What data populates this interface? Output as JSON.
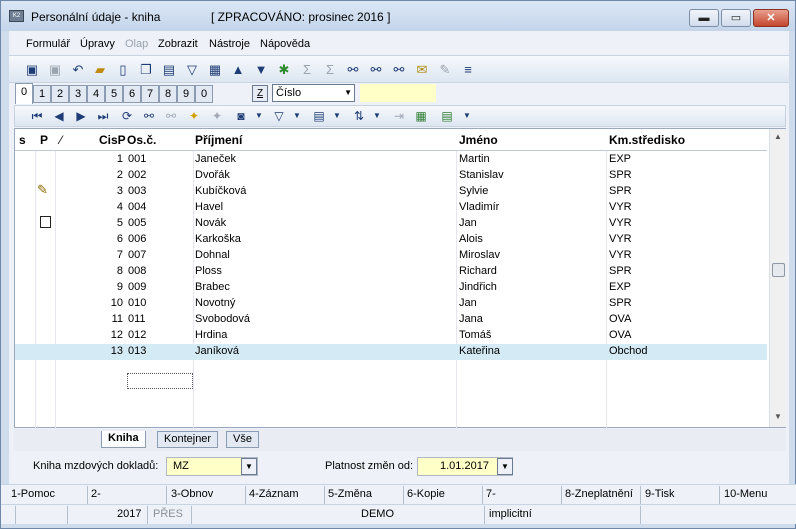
{
  "window": {
    "title": "Personální údaje - kniha",
    "status": "[ ZPRACOVÁNO: prosinec 2016 ]",
    "min_glyph": "▬",
    "max_glyph": "▭",
    "close_glyph": "✕"
  },
  "menu": [
    "Formulář",
    "Úpravy",
    "Olap",
    "Zobrazit",
    "Nástroje",
    "Nápověda"
  ],
  "menu_disabled": [
    "Olap"
  ],
  "toolbar_icons": [
    "save-icon",
    "save-as-icon",
    "undo-icon",
    "open-folder-icon",
    "new-document-icon",
    "copy-icon",
    "book-icon",
    "filter-icon",
    "filter-document-icon",
    "arrow-up-icon",
    "arrow-down-icon",
    "refresh-icon",
    "sum-icon",
    "sum-alt-icon",
    "binoculars-icon",
    "binoculars-next-icon",
    "binoculars-list-icon",
    "mail-icon",
    "edit-icon",
    "list-icon"
  ],
  "number_tabs": [
    "0",
    "1",
    "2",
    "3",
    "4",
    "5",
    "6",
    "7",
    "8",
    "9",
    "0"
  ],
  "sort": {
    "z_label": "Z",
    "selected": "Číslo"
  },
  "nav_toolbar_icons": [
    "first-icon",
    "prev-icon",
    "next-icon",
    "last-icon",
    "refresh-icon",
    "binoculars-icon",
    "binoculars-disabled-icon",
    "star-add-icon",
    "star-remove-icon",
    "camera-icon",
    "filter-icon",
    "columns-icon",
    "sort-icon",
    "indent-icon",
    "excel-icon",
    "notes-icon"
  ],
  "table": {
    "headers": {
      "s": "s",
      "p": "P",
      "mark": "⁄",
      "cisp": "CisP",
      "osc": "Os.č.",
      "prijmeni": "Příjmení",
      "jmeno": "Jméno",
      "stredisko": "Km.středisko"
    },
    "rows": [
      {
        "cisp": "1",
        "osc": "001",
        "prijmeni": "Janeček",
        "jmeno": "Martin",
        "stredisko": "EXP"
      },
      {
        "cisp": "2",
        "osc": "002",
        "prijmeni": "Dvořák",
        "jmeno": "Stanislav",
        "stredisko": "SPR"
      },
      {
        "cisp": "3",
        "osc": "003",
        "prijmeni": "Kubíčková",
        "jmeno": "Sylvie",
        "stredisko": "SPR"
      },
      {
        "cisp": "4",
        "osc": "004",
        "prijmeni": "Havel",
        "jmeno": "Vladimír",
        "stredisko": "VYR"
      },
      {
        "cisp": "5",
        "osc": "005",
        "prijmeni": "Novák",
        "jmeno": "Jan",
        "stredisko": "VYR"
      },
      {
        "cisp": "6",
        "osc": "006",
        "prijmeni": "Karkoška",
        "jmeno": "Alois",
        "stredisko": "VYR"
      },
      {
        "cisp": "7",
        "osc": "007",
        "prijmeni": "Dohnal",
        "jmeno": "Miroslav",
        "stredisko": "VYR"
      },
      {
        "cisp": "8",
        "osc": "008",
        "prijmeni": "Ploss",
        "jmeno": "Richard",
        "stredisko": "SPR"
      },
      {
        "cisp": "9",
        "osc": "009",
        "prijmeni": "Brabec",
        "jmeno": "Jindřich",
        "stredisko": "EXP"
      },
      {
        "cisp": "10",
        "osc": "010",
        "prijmeni": "Novotný",
        "jmeno": "Jan",
        "stredisko": "SPR"
      },
      {
        "cisp": "11",
        "osc": "011",
        "prijmeni": "Svobodová",
        "jmeno": "Jana",
        "stredisko": "OVA"
      },
      {
        "cisp": "12",
        "osc": "012",
        "prijmeni": "Hrdina",
        "jmeno": "Tomáš",
        "stredisko": "OVA"
      },
      {
        "cisp": "13",
        "osc": "013",
        "prijmeni": "Janíková",
        "jmeno": "Kateřina",
        "stredisko": "Obchod"
      }
    ],
    "selected_row": 13
  },
  "bottom_tabs": [
    "Kniha",
    "Kontejner",
    "Vše"
  ],
  "form": {
    "kniha_label": "Kniha mzdových dokladů:",
    "kniha_value": "MZ",
    "platnost_label": "Platnost změn od:",
    "platnost_value": "1.01.2017"
  },
  "fkeys": [
    "1-Pomoc",
    "2-",
    "3-Obnov",
    "4-Záznam",
    "5-Změna",
    "6-Kopie",
    "7-",
    "8-Zneplatnění",
    "9-Tisk",
    "10-Menu"
  ],
  "status": {
    "year": "2017",
    "pres": "PŘES",
    "db": "DEMO",
    "mode": "implicitní"
  },
  "colors": {
    "selected_row": "#d4ebf5",
    "input_yellow": "#ffffc8",
    "chrome": "#eef2f8"
  }
}
